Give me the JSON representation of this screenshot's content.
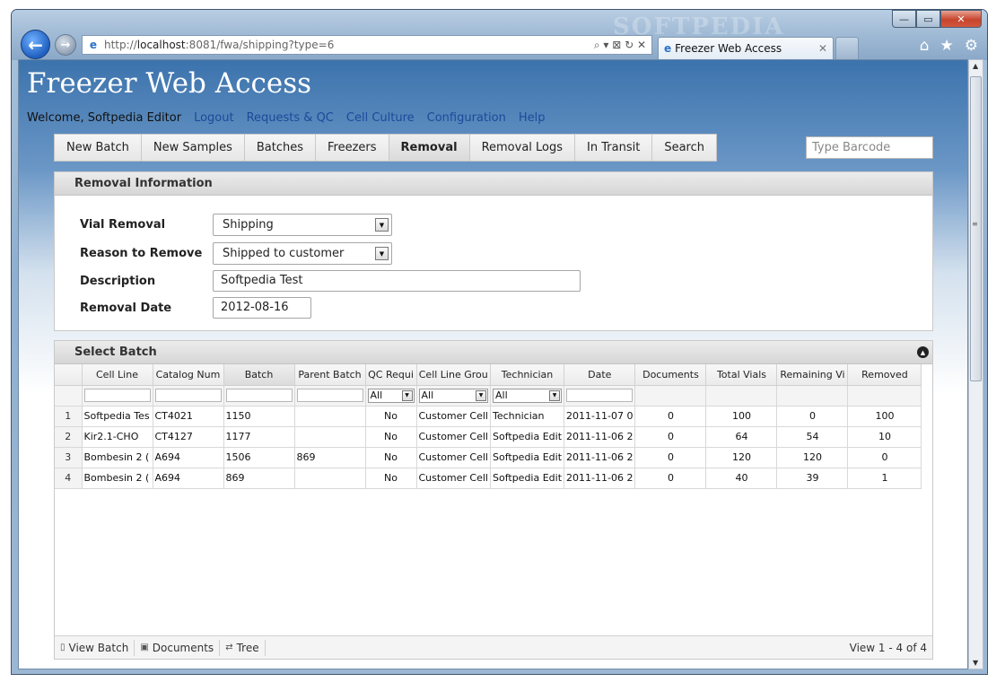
{
  "window": {
    "watermark": "SOFTPEDIA",
    "minimize": "—",
    "maximize": "▭",
    "close": "✕"
  },
  "browser": {
    "back_icon": "arrow-left-icon",
    "forward_icon": "arrow-right-icon",
    "url_prefix": "http://",
    "url_host": "localhost",
    "url_rest": ":8081/fwa/shipping?type=6",
    "address_tools": "⌕ ▾ ⊠ ↻ ✕",
    "tab_title": "Freezer Web Access",
    "tab_close": "✕",
    "home": "⌂",
    "favorites": "★",
    "settings": "⚙"
  },
  "app": {
    "title": "Freezer Web Access",
    "welcome": "Welcome, Softpedia Editor",
    "links": [
      "Logout",
      "Requests & QC",
      "Cell Culture",
      "Configuration",
      "Help"
    ]
  },
  "nav": {
    "items": [
      "New Batch",
      "New Samples",
      "Batches",
      "Freezers",
      "Removal",
      "Removal Logs",
      "In Transit",
      "Search"
    ],
    "active": "Removal",
    "barcode_placeholder": "Type Barcode"
  },
  "removal_info": {
    "header": "Removal Information",
    "vial_removal_label": "Vial Removal",
    "vial_removal_value": "Shipping",
    "reason_label": "Reason to Remove",
    "reason_value": "Shipped to customer",
    "description_label": "Description",
    "description_value": "Softpedia Test",
    "date_label": "Removal Date",
    "date_value": "2012-08-16"
  },
  "select_batch": {
    "header": "Select Batch",
    "columns": [
      "Cell Line",
      "Catalog Num",
      "Batch",
      "Parent Batch",
      "QC Requi",
      "Cell Line Grou",
      "Technician",
      "Date",
      "Documents",
      "Total Vials",
      "Remaining Vi",
      "Removed"
    ],
    "filter_all": "All",
    "rows": [
      {
        "n": "1",
        "cell_line": "Softpedia Tes",
        "catalog": "CT4021",
        "batch": "1150",
        "parent": "",
        "qc": "No",
        "group": "Customer Cell",
        "tech": "Technician",
        "date": "2011-11-07 0",
        "docs": "0",
        "total": "100",
        "remaining": "0",
        "removed": "100"
      },
      {
        "n": "2",
        "cell_line": "Kir2.1-CHO",
        "catalog": "CT4127",
        "batch": "1177",
        "parent": "",
        "qc": "No",
        "group": "Customer Cell",
        "tech": "Softpedia Edit",
        "date": "2011-11-06 2",
        "docs": "0",
        "total": "64",
        "remaining": "54",
        "removed": "10"
      },
      {
        "n": "3",
        "cell_line": "Bombesin 2 (",
        "catalog": "A694",
        "batch": "1506",
        "parent": "869",
        "qc": "No",
        "group": "Customer Cell",
        "tech": "Softpedia Edit",
        "date": "2011-11-06 2",
        "docs": "0",
        "total": "120",
        "remaining": "120",
        "removed": "0"
      },
      {
        "n": "4",
        "cell_line": "Bombesin 2 (",
        "catalog": "A694",
        "batch": "869",
        "parent": "",
        "qc": "No",
        "group": "Customer Cell",
        "tech": "Softpedia Edit",
        "date": "2011-11-06 2",
        "docs": "0",
        "total": "40",
        "remaining": "39",
        "removed": "1"
      }
    ],
    "pager": {
      "view_batch": "View Batch",
      "documents": "Documents",
      "tree": "Tree",
      "view_info": "View 1 - 4 of 4"
    }
  }
}
